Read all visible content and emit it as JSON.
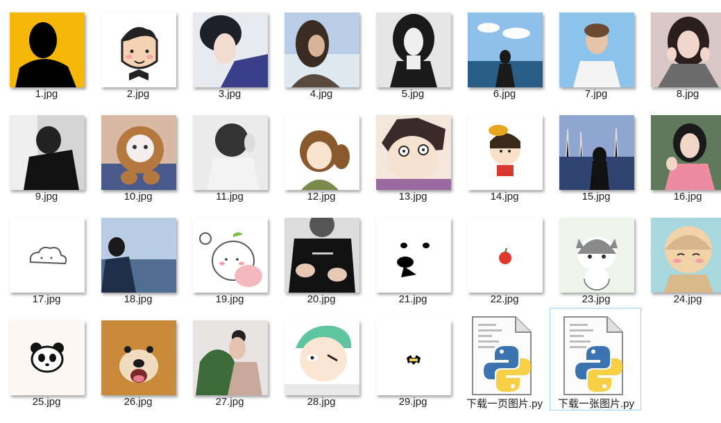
{
  "files": [
    {
      "name": "1.jpg",
      "icon": "silhouette-image-icon",
      "colors": [
        "#f6b708",
        "#000000"
      ]
    },
    {
      "name": "2.jpg",
      "icon": "cartoon-boy-image-icon",
      "colors": [
        "#ffffff",
        "#222222"
      ]
    },
    {
      "name": "3.jpg",
      "icon": "anime-portrait-image-icon",
      "colors": [
        "#e9e9f0",
        "#3b3f8a"
      ]
    },
    {
      "name": "4.jpg",
      "icon": "woman-sky-photo-icon",
      "colors": [
        "#b9cde6",
        "#5a4a3e"
      ]
    },
    {
      "name": "5.jpg",
      "icon": "woman-bw-photo-icon",
      "colors": [
        "#e6e6e6",
        "#1a1a1a"
      ]
    },
    {
      "name": "6.jpg",
      "icon": "sea-girl-photo-icon",
      "colors": [
        "#6fa6da",
        "#2a4d6e"
      ]
    },
    {
      "name": "7.jpg",
      "icon": "man-blue-photo-icon",
      "colors": [
        "#8cc3ea",
        "#f4f4f4"
      ]
    },
    {
      "name": "8.jpg",
      "icon": "girl-portrait-photo-icon",
      "colors": [
        "#d9c8c5",
        "#2a1f1d"
      ]
    },
    {
      "name": "9.jpg",
      "icon": "man-bw-photo-icon",
      "colors": [
        "#d4d4d4",
        "#111111"
      ]
    },
    {
      "name": "10.jpg",
      "icon": "cat-hood-photo-icon",
      "colors": [
        "#d8b9a4",
        "#a9652f"
      ]
    },
    {
      "name": "11.jpg",
      "icon": "girl-bw-photo-icon",
      "colors": [
        "#ececec",
        "#333333"
      ]
    },
    {
      "name": "12.jpg",
      "icon": "anime-girl-image-icon",
      "colors": [
        "#ffffff",
        "#8a5a2e"
      ]
    },
    {
      "name": "13.jpg",
      "icon": "anime-boy-image-icon",
      "colors": [
        "#f3e6dc",
        "#3a2a2a"
      ]
    },
    {
      "name": "14.jpg",
      "icon": "cartoon-kid-image-icon",
      "colors": [
        "#ffffff",
        "#e8a620"
      ]
    },
    {
      "name": "15.jpg",
      "icon": "harbor-girl-photo-icon",
      "colors": [
        "#6b86b8",
        "#1e2a47"
      ]
    },
    {
      "name": "16.jpg",
      "icon": "girl-smile-photo-icon",
      "colors": [
        "#5e7a5a",
        "#ef8ba0"
      ]
    },
    {
      "name": "17.jpg",
      "icon": "cloud-doodle-image-icon",
      "colors": [
        "#ffffff",
        "#555555"
      ]
    },
    {
      "name": "18.jpg",
      "icon": "man-sea-photo-icon",
      "colors": [
        "#8fb3d9",
        "#1f2f47"
      ]
    },
    {
      "name": "19.jpg",
      "icon": "cute-sprout-image-icon",
      "colors": [
        "#ffffff",
        "#f4b9bf"
      ]
    },
    {
      "name": "20.jpg",
      "icon": "man-black-shirt-photo-icon",
      "colors": [
        "#dcdcdc",
        "#111111"
      ]
    },
    {
      "name": "21.jpg",
      "icon": "doge-face-image-icon",
      "colors": [
        "#ffffff",
        "#000000"
      ]
    },
    {
      "name": "22.jpg",
      "icon": "apple-image-icon",
      "colors": [
        "#ffffff",
        "#e0362b"
      ]
    },
    {
      "name": "23.jpg",
      "icon": "cartoon-cat-image-icon",
      "colors": [
        "#eef4ea",
        "#8a8a8a"
      ]
    },
    {
      "name": "24.jpg",
      "icon": "cartoon-monk-image-icon",
      "colors": [
        "#a8d8de",
        "#f2d2a8"
      ]
    },
    {
      "name": "25.jpg",
      "icon": "panda-face-image-icon",
      "colors": [
        "#fdf9f2",
        "#111111"
      ]
    },
    {
      "name": "26.jpg",
      "icon": "shiba-dog-photo-icon",
      "colors": [
        "#c98a3b",
        "#f2dcc0"
      ]
    },
    {
      "name": "27.jpg",
      "icon": "girl-plant-photo-icon",
      "colors": [
        "#e8e4e4",
        "#3d6b3a"
      ]
    },
    {
      "name": "28.jpg",
      "icon": "zoro-anime-image-icon",
      "colors": [
        "#ffffff",
        "#5fc4a0"
      ]
    },
    {
      "name": "29.jpg",
      "icon": "batman-logo-image-icon",
      "colors": [
        "#ffffff",
        "#000000"
      ]
    },
    {
      "name": "下载一页图片.py",
      "icon": "python-file-icon",
      "colors": [
        "#3b74b0",
        "#f7d046"
      ]
    },
    {
      "name": "下载一张图片.py",
      "icon": "python-file-icon",
      "colors": [
        "#3b74b0",
        "#f7d046"
      ],
      "selected": true
    }
  ]
}
